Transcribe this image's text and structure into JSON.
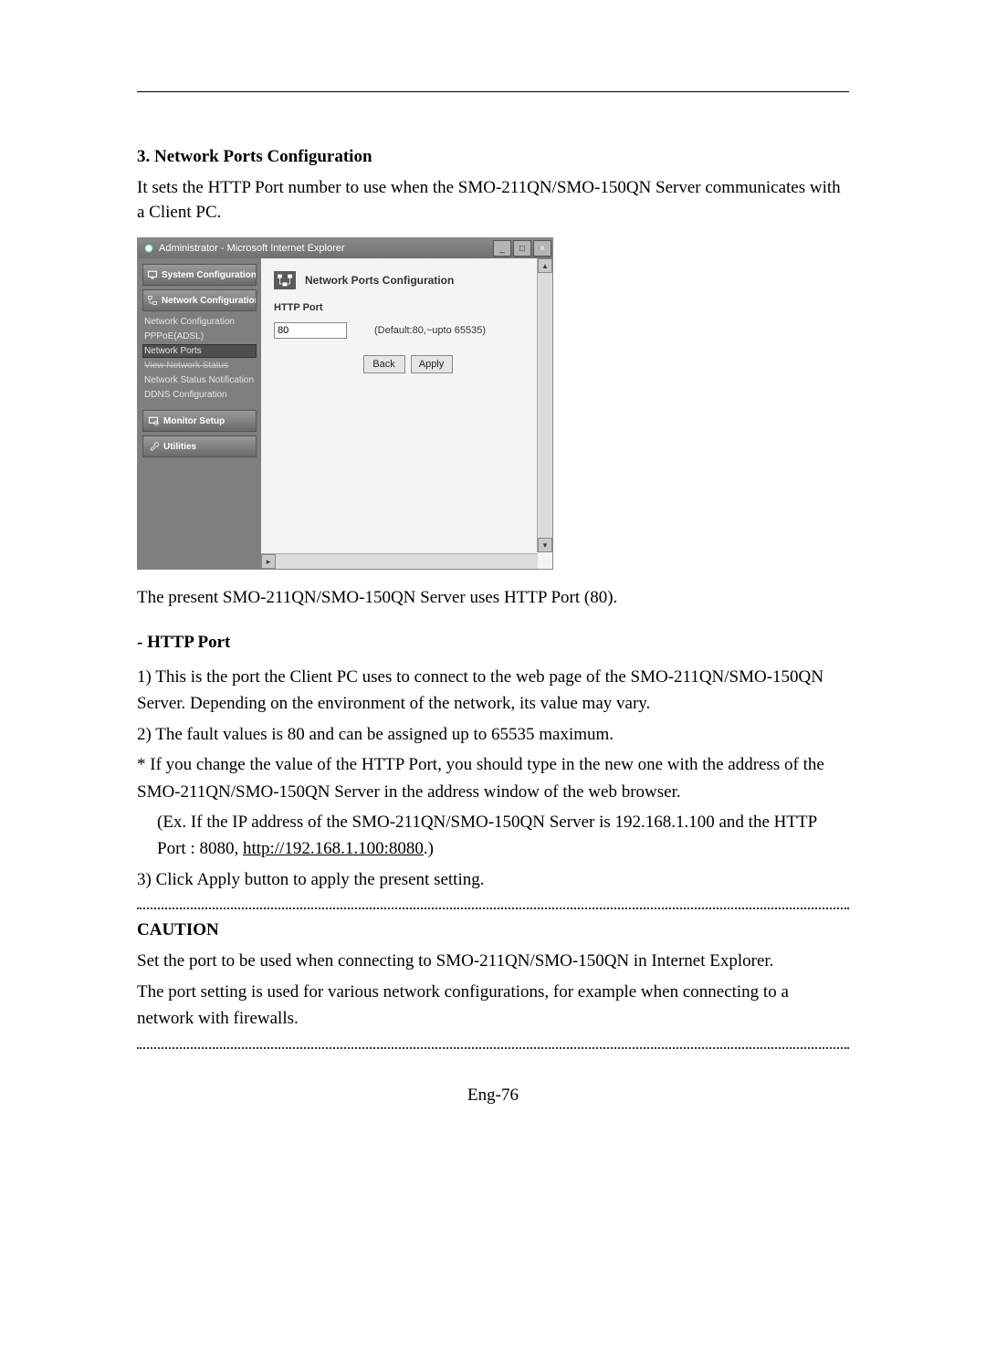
{
  "doc": {
    "section_heading": "3. Network Ports Configuration",
    "intro": "It sets the HTTP Port number to use when the SMO-211QN/SMO-150QN Server communicates with a Client PC.",
    "after_shot": "The present SMO-211QN/SMO-150QN Server uses HTTP Port (80).",
    "http_port_heading": "- HTTP Port",
    "p1": "1) This is the port the Client PC uses to connect to the web page of the SMO-211QN/SMO-150QN Server. Depending on the environment of the network, its value may vary.",
    "p2": "2) The fault values is 80 and can be assigned up to 65535 maximum.",
    "p3a": "* If you change the value of the HTTP Port, you should type in the new one with the address of the SMO-211QN/SMO-150QN Server in the address window of the web browser.",
    "p3b_prefix": "(Ex. If the IP address of the SMO-211QN/SMO-150QN Server is 192.168.1.100 and the HTTP Port : 8080, ",
    "p3b_link": "http://192.168.1.100:8080",
    "p3b_suffix": ".)",
    "p4": "3) Click Apply button to apply the present setting.",
    "caution_heading": "CAUTION",
    "caution_p1": "Set the port to be used when connecting to SMO-211QN/SMO-150QN in Internet Explorer.",
    "caution_p2": "The port setting is used for various network configurations, for example when connecting to a network with firewalls.",
    "page_footer": "Eng-76"
  },
  "window": {
    "title": "Administrator - Microsoft Internet Explorer",
    "buttons": {
      "minimize": "_",
      "maximize": "□",
      "close": "×"
    }
  },
  "sidebar": {
    "system_configuration": "System Configuration",
    "network_configuration": "Network Configuration",
    "subs": {
      "net_conf": "Network Configuration",
      "pppoe": "PPPoE(ADSL)",
      "network_ports": "Network Ports",
      "view_status": "View Network Status",
      "status_notif": "Network Status Notification",
      "ddns": "DDNS Configuration"
    },
    "monitor_setup": "Monitor Setup",
    "utilities": "Utilities"
  },
  "content": {
    "title": "Network Ports Configuration",
    "http_port_label": "HTTP Port",
    "http_port_value": "80",
    "http_port_hint": "(Default:80,~upto 65535)",
    "back_label": "Back",
    "apply_label": "Apply"
  },
  "scroll": {
    "up": "▴",
    "down": "▾",
    "left": "◂",
    "right": "▸"
  }
}
